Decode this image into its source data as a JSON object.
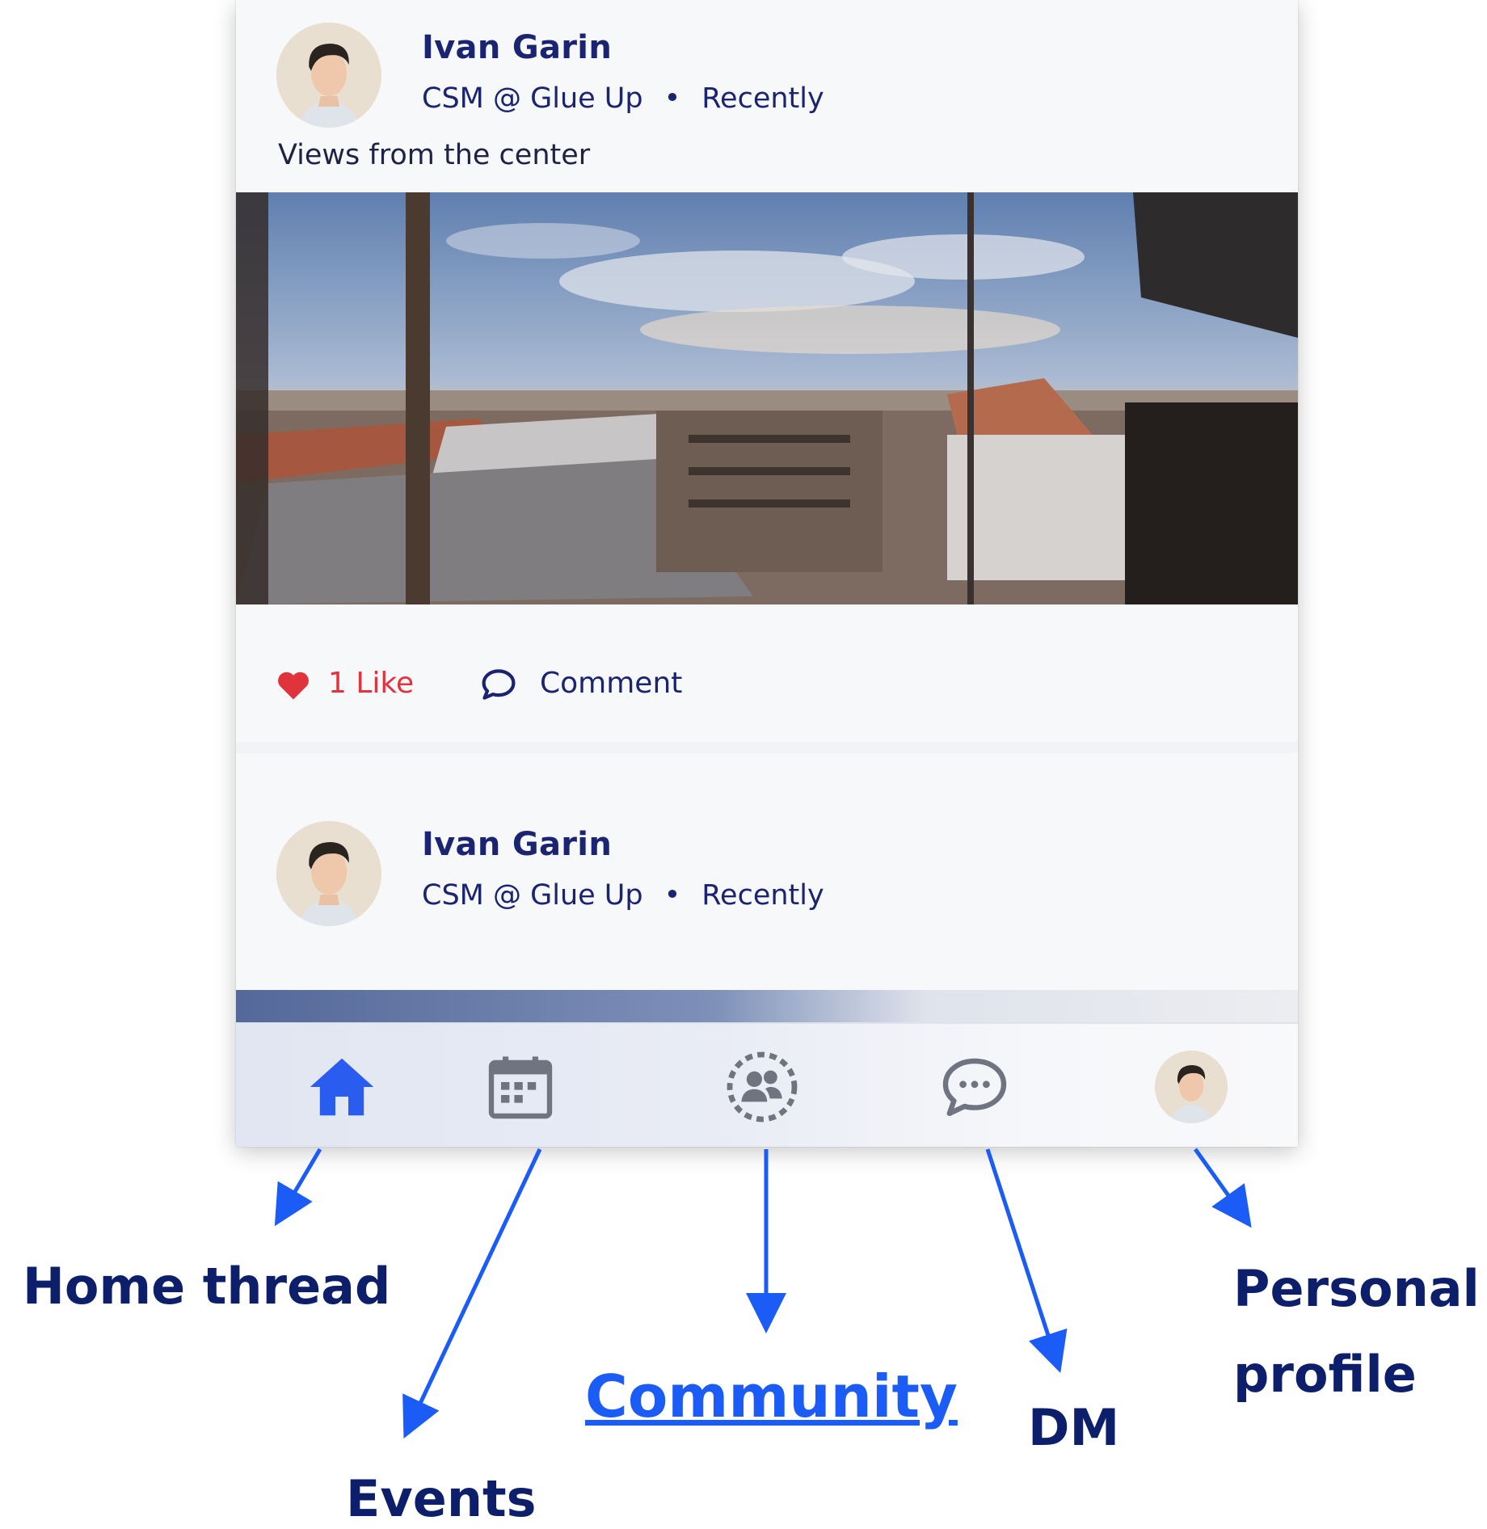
{
  "posts": [
    {
      "author": "Ivan Garin",
      "role": "CSM @ Glue Up",
      "separator": "•",
      "time": "Recently",
      "caption": "Views from the center",
      "likes_label": "1 Like",
      "comment_label": "Comment"
    },
    {
      "author": "Ivan Garin",
      "role": "CSM @ Glue Up",
      "separator": "•",
      "time": "Recently"
    }
  ],
  "nav": {
    "items": [
      {
        "icon": "home-icon",
        "active": true
      },
      {
        "icon": "calendar-icon",
        "active": false
      },
      {
        "icon": "community-icon",
        "active": false
      },
      {
        "icon": "chat-bubble-icon",
        "active": false
      },
      {
        "icon": "profile-avatar-icon",
        "active": false
      }
    ]
  },
  "annotations": {
    "home": "Home thread",
    "events": "Events",
    "community": "Community",
    "dm": "DM",
    "profile_line1": "Personal",
    "profile_line2": "profile"
  },
  "colors": {
    "brand_navy": "#1a2470",
    "like_red": "#e0343c",
    "active_blue": "#2b5cf0",
    "annotation_navy": "#0d1f6b",
    "arrow_blue": "#1a5cf5",
    "inactive_gray": "#707480"
  }
}
